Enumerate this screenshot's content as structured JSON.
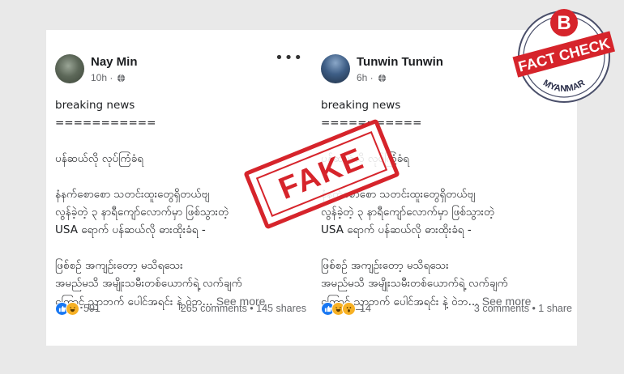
{
  "posts": [
    {
      "author": "Nay Min",
      "time": "10h ·",
      "lines": [
        "breaking news",
        "===========",
        "",
        "ပန်ဆယ်လို လုပ်ကြံခံရ",
        "",
        "နံနက်စောစော သတင်းထူးတွေရှိတယ်ဗျ",
        "လွန်ခဲ့တဲ့ ၃ နာရီကျော်လောက်မှာ ဖြစ်သွားတဲ့",
        "USA ရောက် ပန်ဆယ်လို ဓားထိုးခံရ -",
        "",
        "ဖြစ်စဥ် အကျဥ်းတော့ မသိရသေး",
        "အမည်မသိ အမျိုးသမီးတစ်ယောက်ရဲ့ လက်ချက်"
      ],
      "last_line": "ကြောင့် ညာဘက် ပေါင်အရင်း နဲ့ ဝဲဘ...",
      "see_more": "See more",
      "reaction_count": "591",
      "stats": "265 comments • 145 shares"
    },
    {
      "author": "Tunwin Tunwin",
      "time": "6h ·",
      "lines": [
        "breaking news",
        "===========",
        "",
        "ပန်ဆယ်လို လုပ်ကြံခံရ",
        "",
        "နံနက်စောစော သတင်းထူးတွေရှိတယ်ဗျ",
        "လွန်ခဲ့တဲ့ ၃ နာရီကျော်လောက်မှာ ဖြစ်သွားတဲ့",
        "USA ရောက် ပန်ဆယ်လို ဓားထိုးခံရ -",
        "",
        "ဖြစ်စဥ် အကျဥ်းတော့ မသိရသေး",
        "အမည်မသိ အမျိုးသမီးတစ်ယောက်ရဲ့ လက်ချက်"
      ],
      "last_line": "ကြောင့် ညာဘက် ပေါင်အရင်း နဲ့ ဝဲဘ...",
      "see_more": "See more",
      "reaction_count": "14",
      "stats": "3 comments • 1 share"
    }
  ],
  "stamp": {
    "text": "FAKE",
    "color": "#d6242b"
  },
  "badge": {
    "letter": "B",
    "banner": "FACT CHECK",
    "country": "MYANMAR",
    "color": "#d6242b"
  },
  "icons": {
    "globe": "globe-icon",
    "more": "more-options-icon",
    "like": "like-reaction-icon",
    "haha": "haha-reaction-icon",
    "wow": "wow-reaction-icon"
  }
}
